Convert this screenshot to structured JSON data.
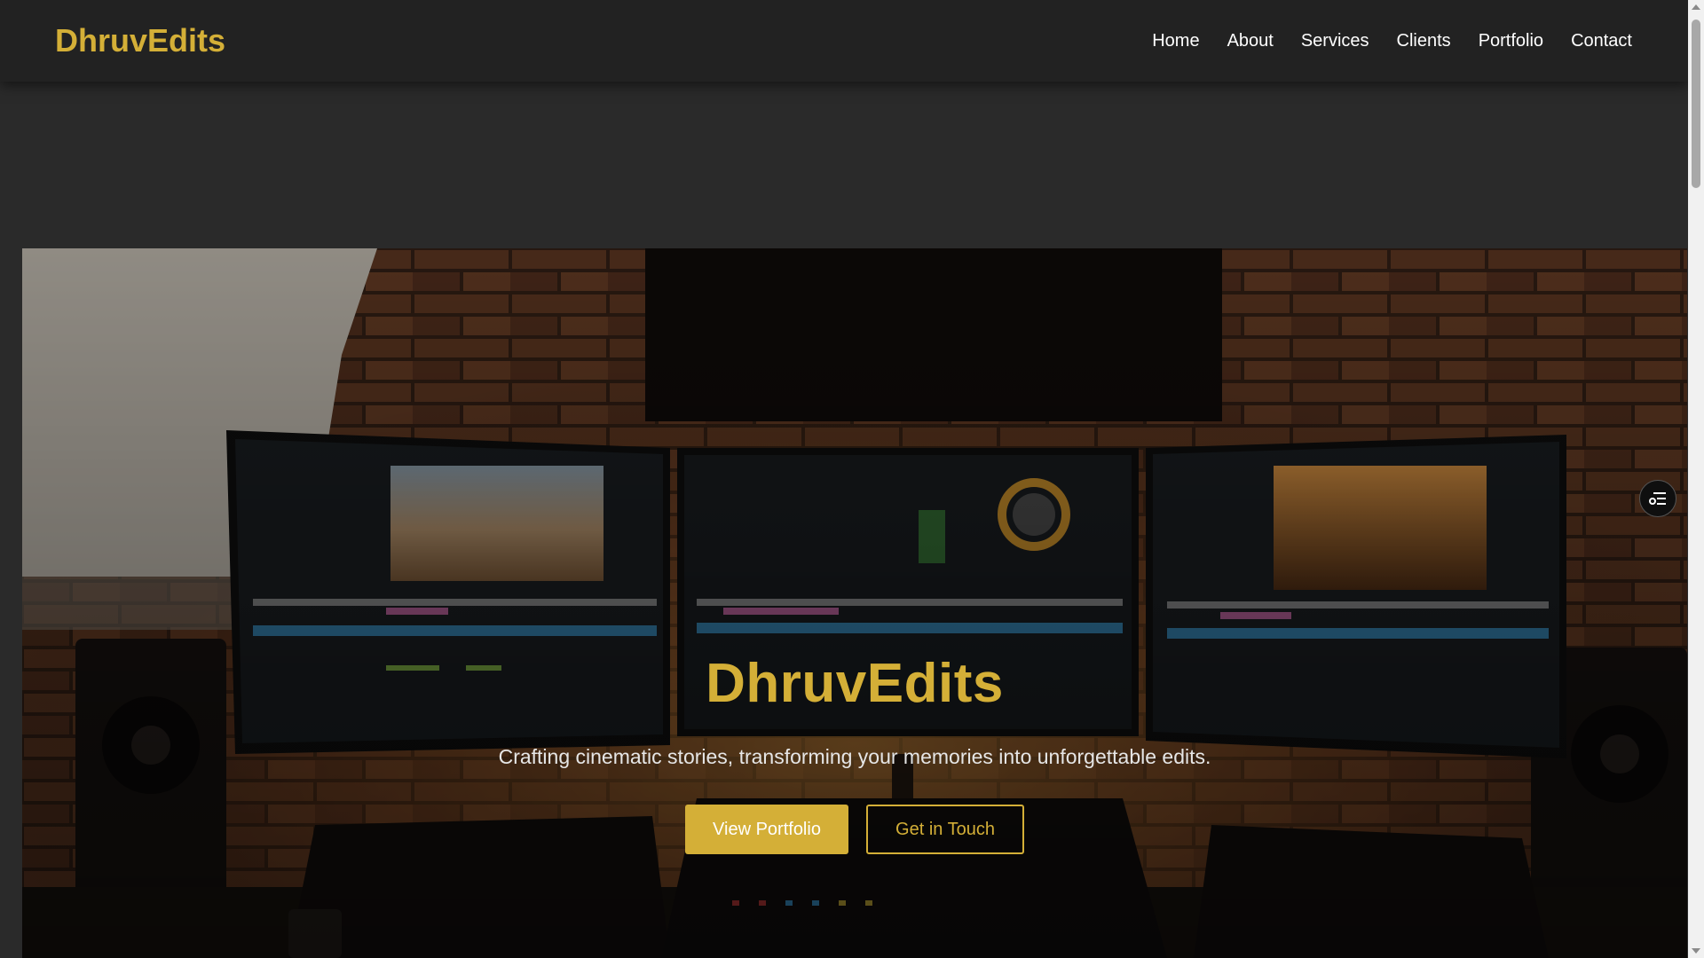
{
  "brand": {
    "name": "DhruvEdits",
    "accent_color": "#d4af37"
  },
  "nav": {
    "items": [
      {
        "label": "Home"
      },
      {
        "label": "About"
      },
      {
        "label": "Services"
      },
      {
        "label": "Clients"
      },
      {
        "label": "Portfolio"
      },
      {
        "label": "Contact"
      }
    ]
  },
  "hero": {
    "title": "DhruvEdits",
    "tagline": "Crafting cinematic stories, transforming your memories into unforgettable edits.",
    "primary_button": "View Portfolio",
    "secondary_button": "Get in Touch",
    "background_image": "video-editing-studio-three-monitors"
  },
  "floating_widget": {
    "icon": "menu-lines-icon"
  }
}
